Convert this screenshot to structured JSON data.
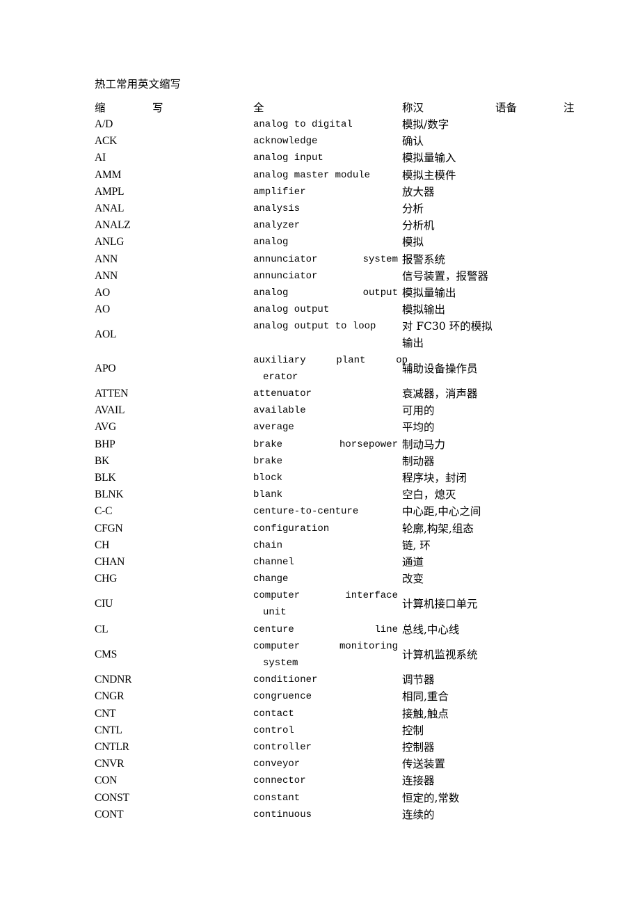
{
  "document": {
    "title": "热工常用英文缩写"
  },
  "table": {
    "headers": {
      "abbr_part1": "缩",
      "abbr_part2": "写",
      "full_part1": "全",
      "cn_part1": "称汉",
      "cn_part2": "语备",
      "note": "注"
    },
    "rows": [
      {
        "abbr": "A/D",
        "english": "analog to digital",
        "chinese": "模拟/数字",
        "note": ""
      },
      {
        "abbr": "ACK",
        "english": "acknowledge",
        "chinese": "确认",
        "note": ""
      },
      {
        "abbr": "AI",
        "english": "analog input",
        "chinese": "模拟量输入",
        "note": ""
      },
      {
        "abbr": "AMM",
        "english": "analog master module",
        "chinese": "模拟主模件",
        "note": ""
      },
      {
        "abbr": "AMPL",
        "english": "amplifier",
        "chinese": "放大器",
        "note": ""
      },
      {
        "abbr": "ANAL",
        "english": "analysis",
        "chinese": "分析",
        "note": ""
      },
      {
        "abbr": "ANALZ",
        "english": "analyzer",
        "chinese": "分析机",
        "note": ""
      },
      {
        "abbr": "ANLG",
        "english": "analog",
        "chinese": "模拟",
        "note": ""
      },
      {
        "abbr": "ANN",
        "english": "annunciator system",
        "english_words": [
          "annunciator",
          "system"
        ],
        "justified": true,
        "chinese": "报警系统",
        "note": ""
      },
      {
        "abbr": "ANN",
        "english": "annunciator",
        "chinese": "信号装置，报警器",
        "note": ""
      },
      {
        "abbr": "AO",
        "english": "analog output",
        "english_words": [
          "analog",
          "output"
        ],
        "justified": true,
        "chinese": "模拟量输出",
        "note": ""
      },
      {
        "abbr": "AO",
        "english": "analog output",
        "chinese": "模拟输出",
        "note": ""
      },
      {
        "abbr": "AOL",
        "english": "analog output to loop",
        "chinese_line1": "对 FC30 环的模拟",
        "chinese_line2": "输出",
        "tall": true,
        "note": ""
      },
      {
        "abbr": "APO",
        "english_line1": "auxiliary plant op",
        "english_line1_words": [
          "auxiliary",
          "plant",
          "op"
        ],
        "english_line2": "erator",
        "justified": true,
        "wide": true,
        "chinese": "辅助设备操作员",
        "tall": true,
        "note": ""
      },
      {
        "abbr": "ATTEN",
        "english": "attenuator",
        "chinese": "衰减器，消声器",
        "note": ""
      },
      {
        "abbr": "AVAIL",
        "english": "available",
        "chinese": "可用的",
        "note": ""
      },
      {
        "abbr": "AVG",
        "english": "average",
        "chinese": "平均的",
        "note": ""
      },
      {
        "abbr": "BHP",
        "english": "brake horsepower",
        "english_words": [
          "brake",
          "horsepower"
        ],
        "justified": true,
        "chinese": "制动马力",
        "note": ""
      },
      {
        "abbr": "BK",
        "english": "brake",
        "chinese": "制动器",
        "note": ""
      },
      {
        "abbr": "BLK",
        "english": "block",
        "chinese": "程序块，封闭",
        "note": ""
      },
      {
        "abbr": "BLNK",
        "english": "blank",
        "chinese": "空白，熄灭",
        "note": ""
      },
      {
        "abbr": "C-C",
        "english": "centure-to-centure",
        "chinese": "中心距,中心之间",
        "note": ""
      },
      {
        "abbr": "CFGN",
        "english": "configuration",
        "chinese": "轮廓,构架,组态",
        "note": ""
      },
      {
        "abbr": "CH",
        "english": "chain",
        "chinese": "链, 环",
        "note": ""
      },
      {
        "abbr": "CHAN",
        "english": "channel",
        "chinese": "通道",
        "note": ""
      },
      {
        "abbr": "CHG",
        "english": "change",
        "chinese": "改变",
        "note": ""
      },
      {
        "abbr": "CIU",
        "english_line1": "computer interface",
        "english_line1_words": [
          "computer",
          "interface"
        ],
        "english_line2": "  unit",
        "justified": true,
        "chinese": "计算机接口单元",
        "tall": true,
        "note": ""
      },
      {
        "abbr": "CL",
        "english": "centure line",
        "english_words": [
          "centure",
          "line"
        ],
        "justified": true,
        "chinese": "总线,中心线",
        "note": ""
      },
      {
        "abbr": "CMS",
        "english_line1": "computer monitoring",
        "english_line1_words": [
          "computer",
          "monitoring"
        ],
        "english_line2": "  system",
        "justified": true,
        "chinese": "计算机监视系统",
        "tall": true,
        "note": ""
      },
      {
        "abbr": "CNDNR",
        "english": "conditioner",
        "chinese": "调节器",
        "note": ""
      },
      {
        "abbr": "CNGR",
        "english": "congruence",
        "chinese": "相同,重合",
        "note": ""
      },
      {
        "abbr": "CNT",
        "english": "contact",
        "chinese": "接触,触点",
        "note": ""
      },
      {
        "abbr": "CNTL",
        "english": "control",
        "chinese": "控制",
        "note": ""
      },
      {
        "abbr": "CNTLR",
        "english": "controller",
        "chinese": "控制器",
        "note": ""
      },
      {
        "abbr": "CNVR",
        "english": "conveyor",
        "chinese": "传送装置",
        "note": ""
      },
      {
        "abbr": "CON",
        "english": "connector",
        "chinese": "连接器",
        "note": ""
      },
      {
        "abbr": "CONST",
        "english": "constant",
        "chinese": "恒定的,常数",
        "note": ""
      },
      {
        "abbr": "CONT",
        "english": "continuous",
        "chinese": "连续的",
        "note": ""
      }
    ]
  }
}
